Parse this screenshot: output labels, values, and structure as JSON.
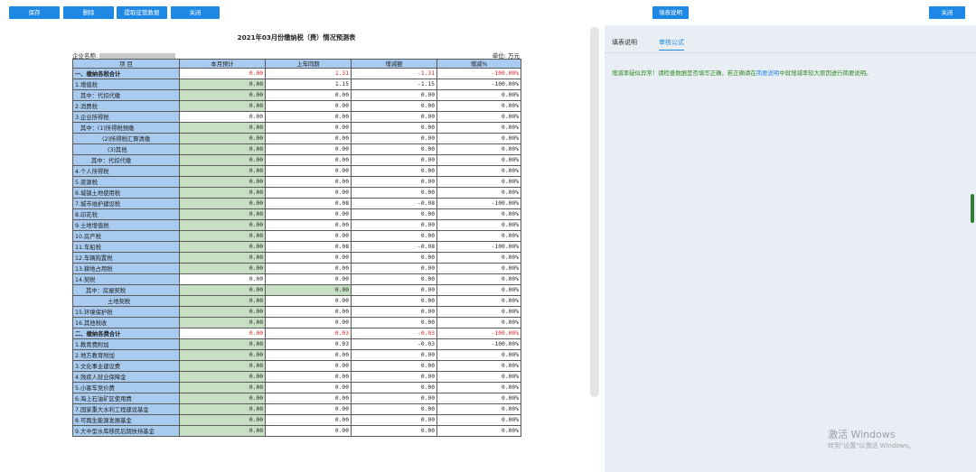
{
  "toolbar": {
    "save": "保存",
    "delete": "删除",
    "fetch": "提取征管数据",
    "close": "关闭",
    "fill_help": "填表说明",
    "close_right": "关闭"
  },
  "report": {
    "title": "2021年03月份缴纳税（费）情况预测表",
    "company_label": "企业名称:",
    "unit": "单位: 万元",
    "headers": [
      "项 目",
      "本月预计",
      "上年同期",
      "增减额",
      "增减%"
    ]
  },
  "rows": [
    {
      "label": "一、缴纳各税合计",
      "indent": 0,
      "bold": true,
      "values": [
        "0.00",
        "1.31",
        "-1.31",
        "-100.00%"
      ],
      "red": true,
      "green": false
    },
    {
      "label": "1.增值税",
      "indent": 0,
      "values": [
        "0.00",
        "1.15",
        "-1.15",
        "-100.00%"
      ],
      "green": true
    },
    {
      "label": "其中：代扣代缴",
      "indent": 1,
      "values": [
        "0.00",
        "0.00",
        "0.00",
        "0.00%"
      ],
      "green": true
    },
    {
      "label": "2.消费税",
      "indent": 0,
      "values": [
        "0.00",
        "0.00",
        "0.00",
        "0.00%"
      ],
      "green": true
    },
    {
      "label": "3.企业所得税",
      "indent": 0,
      "values": [
        "0.00",
        "0.00",
        "0.00",
        "0.00%"
      ],
      "green": false
    },
    {
      "label": "其中：(1)所得税预缴",
      "indent": 1,
      "values": [
        "0.00",
        "0.00",
        "0.00",
        "0.00%"
      ],
      "green": true
    },
    {
      "label": "(2)所得税汇算清缴",
      "indent": 5,
      "values": [
        "0.00",
        "0.00",
        "0.00",
        "0.00%"
      ],
      "green": true
    },
    {
      "label": "(3)其他",
      "indent": 6,
      "values": [
        "0.00",
        "0.00",
        "0.00",
        "0.00%"
      ],
      "green": true
    },
    {
      "label": "其中：代扣代缴",
      "indent": 3,
      "values": [
        "0.00",
        "0.00",
        "0.00",
        "0.00%"
      ],
      "green": true
    },
    {
      "label": "4.个人所得税",
      "indent": 0,
      "values": [
        "0.00",
        "0.00",
        "0.00",
        "0.00%"
      ],
      "green": true
    },
    {
      "label": "5.资源税",
      "indent": 0,
      "values": [
        "0.00",
        "0.00",
        "0.00",
        "0.00%"
      ],
      "green": true
    },
    {
      "label": "6.城镇土地使用税",
      "indent": 0,
      "values": [
        "0.00",
        "0.00",
        "0.00",
        "0.00%"
      ],
      "green": true
    },
    {
      "label": "7.城市维护建设税",
      "indent": 0,
      "values": [
        "0.00",
        "0.08",
        "-0.08",
        "-100.00%"
      ],
      "green": true
    },
    {
      "label": "8.印花税",
      "indent": 0,
      "values": [
        "0.00",
        "0.00",
        "0.00",
        "0.00%"
      ],
      "green": true
    },
    {
      "label": "9.土地增值税",
      "indent": 0,
      "values": [
        "0.00",
        "0.00",
        "0.00",
        "0.00%"
      ],
      "green": true
    },
    {
      "label": "10.房产税",
      "indent": 0,
      "values": [
        "0.00",
        "0.00",
        "0.00",
        "0.00%"
      ],
      "green": true
    },
    {
      "label": "11.车船税",
      "indent": 0,
      "values": [
        "0.00",
        "0.08",
        "-0.08",
        "-100.00%"
      ],
      "green": true
    },
    {
      "label": "12.车辆购置税",
      "indent": 0,
      "values": [
        "0.00",
        "0.00",
        "0.00",
        "0.00%"
      ],
      "green": true
    },
    {
      "label": "13.耕地占用税",
      "indent": 0,
      "values": [
        "0.00",
        "0.00",
        "0.00",
        "0.00%"
      ],
      "green": true
    },
    {
      "label": "14.契税",
      "indent": 0,
      "values": [
        "0.00",
        "0.00",
        "0.00",
        "0.00%"
      ],
      "green": false
    },
    {
      "label": "其中：房屋契税",
      "indent": 2,
      "values": [
        "0.00",
        "0.00",
        "0.00",
        "0.00%"
      ],
      "green": true,
      "green2": true
    },
    {
      "label": "土地契税",
      "indent": 6,
      "values": [
        "0.00",
        "0.00",
        "0.00",
        "0.00%"
      ],
      "green": true
    },
    {
      "label": "15.环境保护税",
      "indent": 0,
      "values": [
        "0.00",
        "0.00",
        "0.00",
        "0.00%"
      ],
      "green": true
    },
    {
      "label": "16.其他税收",
      "indent": 0,
      "values": [
        "0.00",
        "0.00",
        "0.00",
        "0.00%"
      ],
      "green": true
    },
    {
      "label": "二、缴纳各费合计",
      "indent": 0,
      "bold": true,
      "values": [
        "0.00",
        "0.03",
        "-0.03",
        "-100.00%"
      ],
      "red": true,
      "green": false
    },
    {
      "label": "1.教育费附加",
      "indent": 0,
      "values": [
        "0.00",
        "0.03",
        "-0.03",
        "-100.00%"
      ],
      "green": true
    },
    {
      "label": "2.地方教育附加",
      "indent": 0,
      "values": [
        "0.00",
        "0.00",
        "0.00",
        "0.00%"
      ],
      "green": true
    },
    {
      "label": "3.文化事业建设费",
      "indent": 0,
      "values": [
        "0.00",
        "0.00",
        "0.00",
        "0.00%"
      ],
      "green": true
    },
    {
      "label": "4.残疾人就业保障金",
      "indent": 0,
      "values": [
        "0.00",
        "0.00",
        "0.00",
        "0.00%"
      ],
      "green": true
    },
    {
      "label": "5.小客车竞价费",
      "indent": 0,
      "values": [
        "0.00",
        "0.00",
        "0.00",
        "0.00%"
      ],
      "green": true
    },
    {
      "label": "6.海上石油矿区使用费",
      "indent": 0,
      "values": [
        "0.00",
        "0.00",
        "0.00",
        "0.00%"
      ],
      "green": true
    },
    {
      "label": "7.国家重大水利工程建设基金",
      "indent": 0,
      "values": [
        "0.00",
        "0.00",
        "0.00",
        "0.00%"
      ],
      "green": true
    },
    {
      "label": "8.可再生能源发展基金",
      "indent": 0,
      "values": [
        "0.00",
        "0.00",
        "0.00",
        "0.00%"
      ],
      "green": true
    },
    {
      "label": "9.大中型水库移民后期扶持基金",
      "indent": 0,
      "values": [
        "0.00",
        "0.00",
        "0.00",
        "0.00%"
      ],
      "green": true
    }
  ],
  "right_panel": {
    "tabs": [
      "填表说明",
      "审核公式"
    ],
    "active_tab": 1,
    "message_prefix": "增减率疑似异常！请检查数据是否填写正确，若正确请在",
    "message_link": "简要说明",
    "message_suffix": "中就增减率较大原因进行简要说明。"
  },
  "watermark": {
    "line1": "激活 Windows",
    "line2": "转到\"设置\"以激活 Windows。"
  },
  "colors": {
    "button_blue": "#1e88e5",
    "header_blue": "#a8cbef",
    "input_green": "#c7dfc2",
    "alert_red": "#e02020",
    "message_green": "#2e8b1f"
  }
}
